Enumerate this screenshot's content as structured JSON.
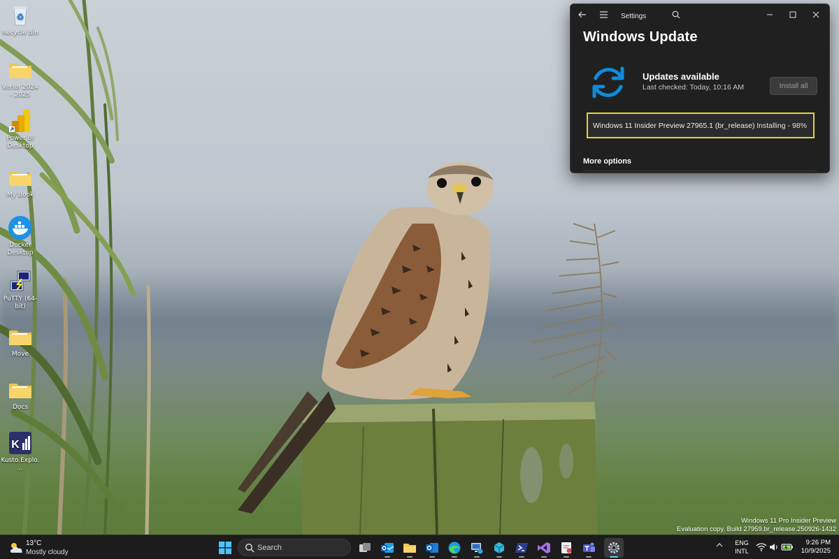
{
  "desktop_icons": [
    {
      "label": "Recycle Bin",
      "icon": "recycle-bin-icon"
    },
    {
      "label": "Verlof 2024 - 2025",
      "icon": "folder-icon"
    },
    {
      "label": "Power BI Desktop",
      "icon": "power-bi-icon"
    },
    {
      "label": "My Book",
      "icon": "folder-icon"
    },
    {
      "label": "Docker Desktop",
      "icon": "docker-icon"
    },
    {
      "label": "PuTTY (64-bit)",
      "icon": "putty-icon"
    },
    {
      "label": "Move",
      "icon": "folder-icon"
    },
    {
      "label": "Docs",
      "icon": "folder-icon"
    },
    {
      "label": "Kusto.Explo...",
      "icon": "kusto-explorer-icon"
    }
  ],
  "settings": {
    "window_title": "Settings",
    "page_title": "Windows Update",
    "status_heading": "Updates available",
    "last_checked": "Last checked: Today, 10:16 AM",
    "install_all_label": "Install all",
    "update_item": {
      "name": "Windows 11 Insider Preview 27965.1 (br_release)",
      "status": "Installing - 98%",
      "progress_percent": 98
    },
    "more_options_label": "More options",
    "accent_color": "#0f8bdc",
    "highlight_color": "#e6d23a"
  },
  "watermark": {
    "line1": "Windows 11 Pro Insider Preview",
    "line2": "Evaluation copy. Build 27959.br_release.250926-1432"
  },
  "taskbar": {
    "weather_temp": "13°C",
    "weather_condition": "Mostly cloudy",
    "search_placeholder": "Search",
    "apps": [
      "start",
      "search",
      "task-view",
      "outlook-new",
      "file-explorer",
      "outlook",
      "edge",
      "remote-desktop",
      "package",
      "powershell",
      "visual-studio",
      "snipping-tool",
      "teams",
      "settings"
    ],
    "lang_line1": "ENG",
    "lang_line2": "INTL",
    "time": "9:26 PM",
    "date": "10/9/2025"
  }
}
